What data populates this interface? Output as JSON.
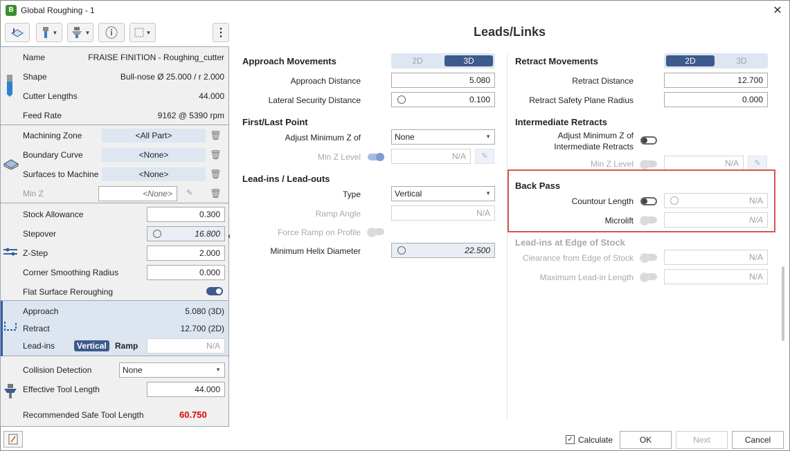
{
  "window": {
    "title": "Global Roughing - 1",
    "close": "✕",
    "app_icon": "B"
  },
  "toolbar": {
    "info_glyph": "ⓘ",
    "more_glyph": "⋮"
  },
  "panel_title": "Leads/Links",
  "tool": {
    "name_label": "Name",
    "name_value": "FRAISE FINITION - Roughing_cutter",
    "shape_label": "Shape",
    "shape_value": "Bull-nose Ø 25.000 / r 2.000",
    "lengths_label": "Cutter Lengths",
    "lengths_value": "44.000",
    "feed_label": "Feed Rate",
    "feed_value": "9162 @ 5390 rpm"
  },
  "zone": {
    "machining_label": "Machining Zone",
    "machining_value": "<All Part>",
    "boundary_label": "Boundary Curve",
    "boundary_value": "<None>",
    "surfaces_label": "Surfaces to Machine",
    "surfaces_value": "<None>",
    "minz_label": "Min Z",
    "minz_value": "<None>"
  },
  "params": {
    "stock_label": "Stock Allowance",
    "stock_value": "0.300",
    "stepover_label": "Stepover",
    "stepover_value": "16.800",
    "zstep_label": "Z-Step",
    "zstep_value": "2.000",
    "corner_label": "Corner Smoothing Radius",
    "corner_value": "0.000",
    "flat_label": "Flat Surface Reroughing"
  },
  "links_summary": {
    "approach_label": "Approach",
    "approach_value": "5.080 (3D)",
    "retract_label": "Retract",
    "retract_value": "12.700 (2D)",
    "leadins_label": "Lead-ins",
    "vertical": "Vertical",
    "ramp": "Ramp",
    "leadins_value": "N/A"
  },
  "collision": {
    "detection_label": "Collision Detection",
    "detection_value": "None",
    "eff_label": "Effective Tool Length",
    "eff_value": "44.000",
    "rec_label": "Recommended Safe Tool Length",
    "rec_value": "60.750",
    "rec_color": "#e00000"
  },
  "approach": {
    "header": "Approach Movements",
    "mode_2d": "2D",
    "mode_3d": "3D",
    "distance_label": "Approach Distance",
    "distance_value": "5.080",
    "lateral_label": "Lateral Security Distance",
    "lateral_value": "0.100"
  },
  "first_last": {
    "header": "First/Last Point",
    "adjust_label": "Adjust Minimum Z of",
    "adjust_value": "None",
    "minz_label": "Min Z Level",
    "minz_value": "N/A"
  },
  "leadins": {
    "header": "Lead-ins / Lead-outs",
    "type_label": "Type",
    "type_value": "Vertical",
    "ramp_label": "Ramp Angle",
    "ramp_value": "N/A",
    "force_label": "Force Ramp on Profile",
    "helix_label": "Minimum Helix Diameter",
    "helix_value": "22.500"
  },
  "retract": {
    "header": "Retract Movements",
    "mode_2d": "2D",
    "mode_3d": "3D",
    "distance_label": "Retract Distance",
    "distance_value": "12.700",
    "radius_label": "Retract Safety Plane Radius",
    "radius_value": "0.000"
  },
  "intermediate": {
    "header": "Intermediate Retracts",
    "adjust_label_1": "Adjust Minimum Z of",
    "adjust_label_2": "Intermediate Retracts",
    "minz_label": "Min Z Level",
    "minz_value": "N/A"
  },
  "back_pass": {
    "header": "Back Pass",
    "contour_label": "Countour Length",
    "contour_value": "N/A",
    "microlift_label": "Microlift",
    "microlift_value": "N/A",
    "highlight_color": "#d9534f"
  },
  "edge_stock": {
    "header": "Lead-ins at Edge of Stock",
    "clearance_label": "Clearance from Edge of Stock",
    "clearance_value": "N/A",
    "max_label": "Maximum Lead-in Length",
    "max_value": "N/A"
  },
  "footer": {
    "calculate_label": "Calculate",
    "calculate_checked": "✓",
    "ok": "OK",
    "next": "Next",
    "cancel": "Cancel"
  },
  "colors": {
    "accent": "#3d5a8c",
    "field_shade": "#dde6f1"
  }
}
